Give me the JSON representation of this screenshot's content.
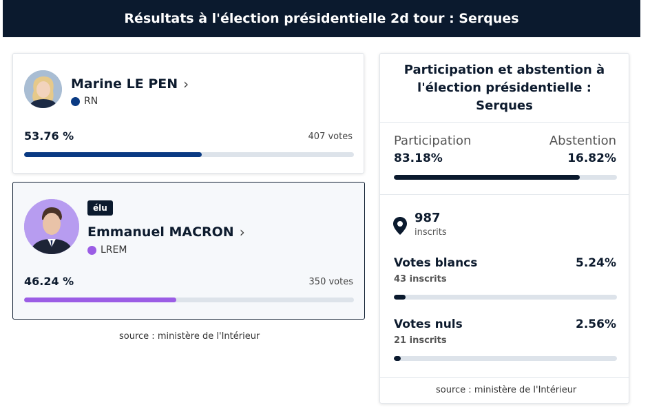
{
  "header": {
    "title": "Résultats à l'élection présidentielle 2d tour : Serques"
  },
  "candidates": [
    {
      "name": "Marine LE PEN",
      "chevron": "›",
      "party": "RN",
      "party_color": "#0a3a83",
      "percent": "53.76 %",
      "percent_value": 53.76,
      "votes": "407 votes",
      "bar_color": "#0a3a83"
    },
    {
      "badge": "élu",
      "name": "Emmanuel MACRON",
      "chevron": "›",
      "party": "LREM",
      "party_color": "#9b5de5",
      "percent": "46.24 %",
      "percent_value": 46.24,
      "votes": "350 votes",
      "bar_color": "#9b5de5"
    }
  ],
  "left_source": "source : ministère de l'Intérieur",
  "participation": {
    "title": "Participation et abstention à l'élection présidentielle : Serques",
    "participation_label": "Participation",
    "abstention_label": "Abstention",
    "participation_value": "83.18%",
    "abstention_value": "16.82%",
    "participation_fraction": 0.8318,
    "inscrits_count": "987",
    "inscrits_label": "inscrits",
    "blancs_label": "Votes blancs",
    "blancs_pct": "5.24%",
    "blancs_fraction": 0.0524,
    "blancs_sub": "43 inscrits",
    "nuls_label": "Votes nuls",
    "nuls_pct": "2.56%",
    "nuls_fraction": 0.0256,
    "nuls_sub": "21 inscrits",
    "source": "source : ministère de l'Intérieur",
    "dark_color": "#0b1a2e"
  }
}
